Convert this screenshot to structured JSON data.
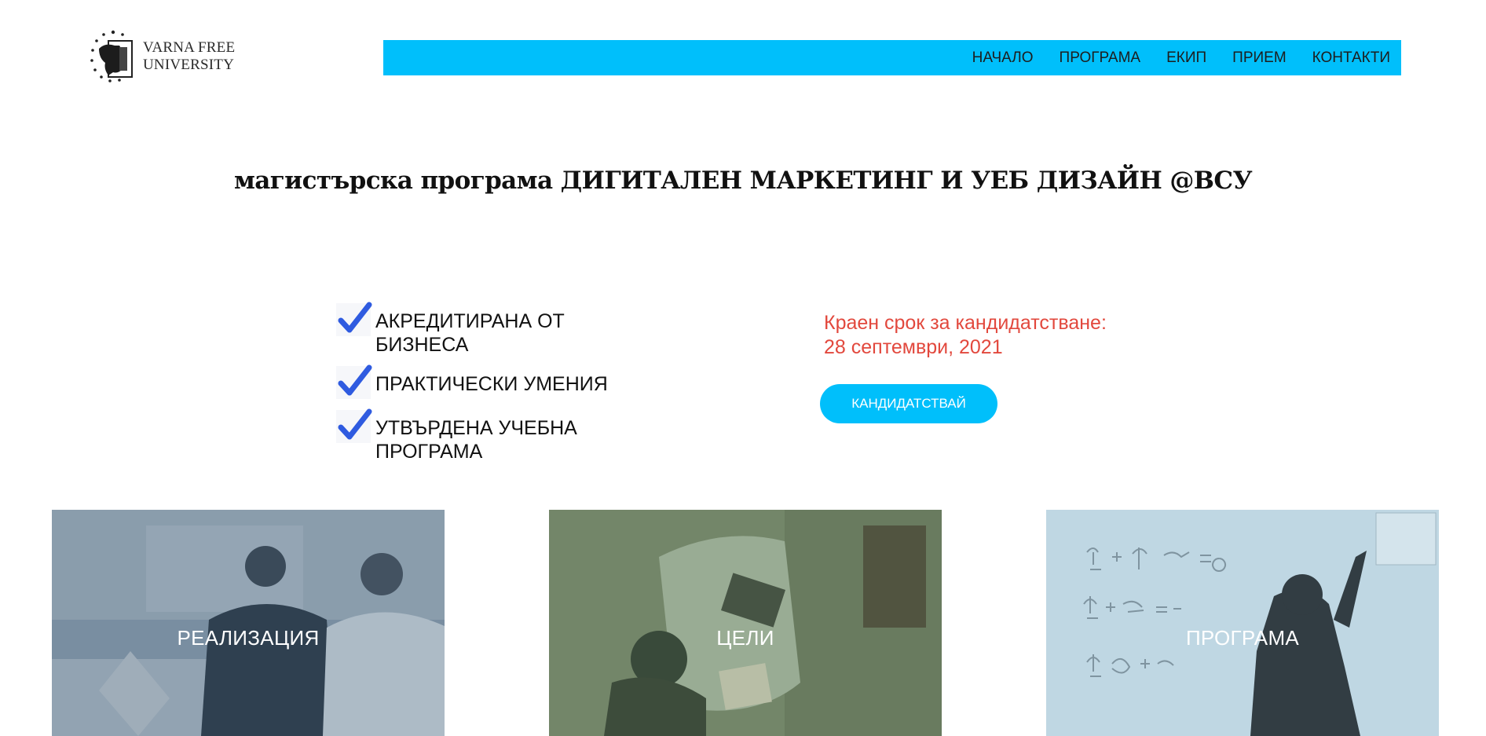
{
  "logo": {
    "line1": "VARNA FREE",
    "line2": "UNIVERSITY"
  },
  "nav": {
    "items": [
      "НАЧАЛО",
      "ПРОГРАМА",
      "ЕКИП",
      "ПРИЕМ",
      "КОНТАКТИ"
    ]
  },
  "hero": {
    "title": "магистърска програма ДИГИТАЛЕН МАРКЕТИНГ И УЕБ ДИЗАЙН @ВСУ"
  },
  "features": [
    {
      "label": "АКРЕДИТИРАНА ОТ БИЗНЕСА",
      "icon": "checkmark-icon"
    },
    {
      "label": "ПРАКТИЧЕСКИ УМЕНИЯ",
      "icon": "checkmark-icon"
    },
    {
      "label": "УТВЪРДЕНА УЧЕБНА ПРОГРАМА",
      "icon": "checkmark-icon"
    }
  ],
  "deadline": {
    "line1": "Краен срок за кандидатстване:",
    "line2": "28 септември, 2021"
  },
  "apply_button": {
    "label": "КАНДИДАТСТВАЙ"
  },
  "cards": [
    {
      "label": "РЕАЛИЗАЦИЯ"
    },
    {
      "label": "ЦЕЛИ"
    },
    {
      "label": "ПРОГРАМА"
    }
  ],
  "colors": {
    "accent": "#00bffb",
    "deadline_text": "#e2483d",
    "checkmark": "#2f5be0",
    "card_1_overlay": "#4f6b82",
    "card_2_overlay": "#5f7a5a",
    "card_3_overlay": "#a9c9d9"
  }
}
